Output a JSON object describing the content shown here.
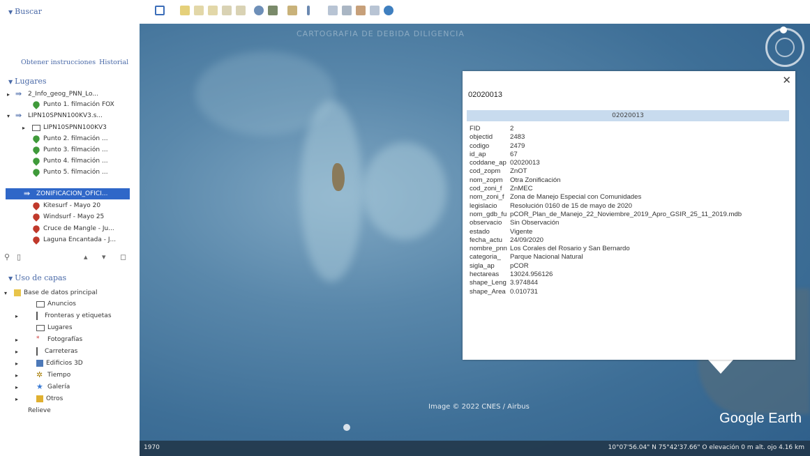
{
  "sidebar": {
    "search": "Buscar",
    "links": [
      "Obtener instrucciones",
      "Historial"
    ],
    "places_header": "Lugares",
    "places": [
      {
        "label": "2_Info_geog_PNN_Lo...",
        "icon": "link"
      },
      {
        "label": "Punto 1. filmación FOX",
        "icon": "green"
      },
      {
        "label": "LIPN10SPNN100KV3.s...",
        "icon": "link"
      },
      {
        "label": "LIPN10SPNN100KV3",
        "icon": "folder"
      },
      {
        "label": "Punto 2. filmación ...",
        "icon": "green"
      },
      {
        "label": "Punto 3. filmación ...",
        "icon": "green"
      },
      {
        "label": "Punto 4. filmación ...",
        "icon": "green"
      },
      {
        "label": "Punto 5. filmación ...",
        "icon": "green"
      },
      {
        "label": "ZONIFICACION_OFICI...",
        "icon": "link"
      },
      {
        "label": "Kitesurf - Mayo 20",
        "icon": "red"
      },
      {
        "label": "Windsurf - Mayo 25",
        "icon": "red"
      },
      {
        "label": "Cruce de Mangle - Ju...",
        "icon": "red"
      },
      {
        "label": "Laguna Encantada - J...",
        "icon": "red"
      }
    ],
    "layers_header": "Uso de capas",
    "layers": [
      {
        "label": "Base de datos principal"
      },
      {
        "label": "Anuncios"
      },
      {
        "label": "Fronteras y etiquetas"
      },
      {
        "label": "Lugares"
      },
      {
        "label": "Fotografías"
      },
      {
        "label": "Carreteras"
      },
      {
        "label": "Edificios 3D"
      },
      {
        "label": "Tiempo"
      },
      {
        "label": "Galería"
      },
      {
        "label": "Otros"
      },
      {
        "label": "Relieve"
      }
    ]
  },
  "map": {
    "faint_title": "CARTOGRAFIA DE DEBIDA DILIGENCIA",
    "credit": "Image © 2022 CNES / Airbus",
    "logo": "Google Earth",
    "status_left": "1970",
    "status_right": "10°07'56.04\" N   75°42'37.66\" O  elevación   0 m    alt. ojo  4.16 km"
  },
  "balloon": {
    "title": "02020013",
    "header": "02020013",
    "rows": [
      [
        "FID",
        "2"
      ],
      [
        "objectid",
        "2483"
      ],
      [
        "codigo",
        "2479"
      ],
      [
        "id_ap",
        "67"
      ],
      [
        "coddane_ap",
        "02020013"
      ],
      [
        "cod_zopm",
        "ZnOT"
      ],
      [
        "nom_zopm",
        "Otra Zonificación"
      ],
      [
        "cod_zoni_f",
        "ZnMEC"
      ],
      [
        "nom_zoni_f",
        "Zona de Manejo Especial con Comunidades"
      ],
      [
        "legislacio",
        "Resolución 0160 de 15 de mayo de 2020"
      ],
      [
        "nom_gdb_fu",
        "pCOR_Plan_de_Manejo_22_Noviembre_2019_Apro_GSIR_25_11_2019.mdb"
      ],
      [
        "observacio",
        "Sin Observación"
      ],
      [
        "estado",
        "Vigente"
      ],
      [
        "fecha_actu",
        "24/09/2020"
      ],
      [
        "nombre_pnn",
        "Los Corales del Rosario y San Bernardo"
      ],
      [
        "categoria_",
        "Parque Nacional Natural"
      ],
      [
        "sigla_ap",
        "pCOR"
      ],
      [
        "hectareas",
        "13024.956126"
      ],
      [
        "shape_Leng",
        "3.974844"
      ],
      [
        "shape_Area",
        "0.010731"
      ]
    ]
  }
}
